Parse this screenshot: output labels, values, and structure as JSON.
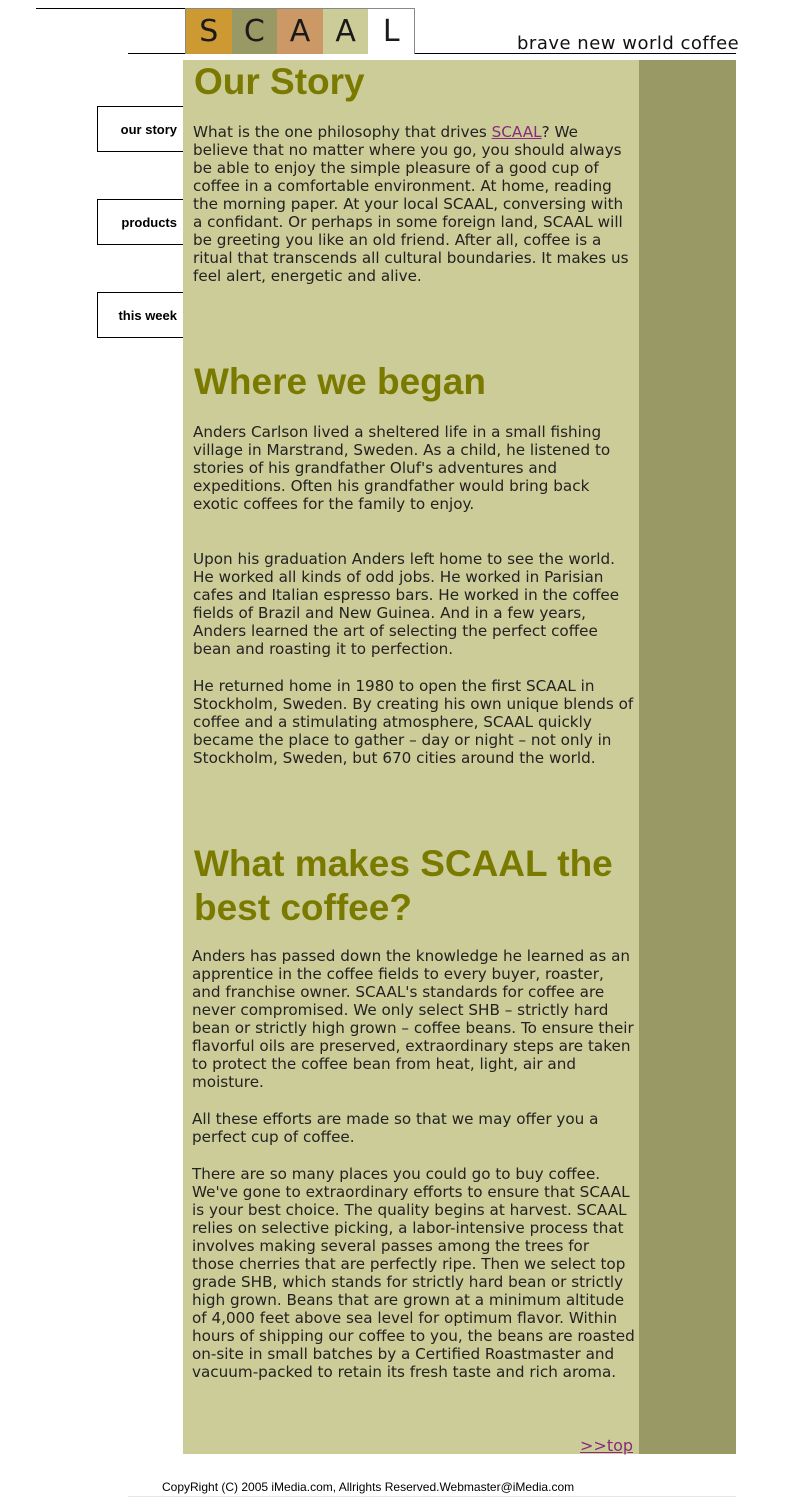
{
  "logo": {
    "letters": [
      "S",
      "C",
      "A",
      "A",
      "L"
    ],
    "colors": [
      "#cc9933",
      "#999966",
      "#cc9966",
      "#cccc99",
      "#ffffff"
    ]
  },
  "tagline": "brave new world coffee",
  "nav": {
    "items": [
      {
        "label": "our story"
      },
      {
        "label": "products"
      },
      {
        "label": "this week"
      }
    ]
  },
  "colors": {
    "content_bg": "#cccc99",
    "sidebar_bg": "#999966",
    "heading": "#7a7a00",
    "link": "#8a2a7a"
  },
  "sections": {
    "our_story": {
      "heading": "Our Story",
      "p1_before": "What is the one philosophy that drives ",
      "p1_link": "SCAAL",
      "p1_after": "? We believe that no matter where you go, you should always be able to enjoy the simple pleasure of a good cup of coffee in a comfortable environment. At home, reading the morning paper. At your local SCAAL, conversing with a confidant. Or perhaps in some foreign land, SCAAL will be greeting you like an old friend. After all, coffee is a ritual that transcends all cultural boundaries. It makes us feel alert, energetic and alive."
    },
    "where_we_began": {
      "heading": "Where we began",
      "paragraphs": [
        "Anders Carlson lived a sheltered life in a small fishing village in Marstrand, Sweden. As a child, he listened to stories of his grandfather Oluf's adventures and expeditions. Often his grandfather would bring back exotic coffees for the family to enjoy.",
        "Upon his graduation Anders left home to see the world. He worked all kinds of odd jobs. He worked in Parisian cafes and Italian espresso bars. He worked in the coffee fields of Brazil and New Guinea. And in a few years, Anders learned the art of selecting the perfect coffee bean and roasting it to perfection.",
        "He returned home in 1980 to open the first SCAAL in Stockholm, Sweden. By creating his own unique blends of coffee and a stimulating atmosphere, SCAAL quickly became the place to gather – day or night – not only in Stockholm, Sweden, but 670 cities around the world."
      ]
    },
    "best_coffee": {
      "heading": "What makes SCAAL the best coffee?",
      "paragraphs": [
        " Anders has passed down the knowledge he learned as an apprentice in the coffee fields to every buyer, roaster, and franchise owner. SCAAL's standards for coffee are never compromised. We only select SHB – strictly hard bean or strictly high grown – coffee beans. To ensure their flavorful oils are preserved, extraordinary steps are taken to protect the coffee bean from heat, light, air and moisture.",
        "All these efforts are made so that we may offer you a perfect cup of coffee.",
        "There are so many places you could go to buy coffee. We've gone to extraordinary efforts to ensure that SCAAL is your best choice. The quality begins at harvest. SCAAL relies on selective picking, a labor-intensive process that involves making several passes among the trees for those cherries that are perfectly ripe. Then we select top grade SHB, which stands for strictly hard bean or strictly high grown. Beans that are grown at a minimum altitude of 4,000 feet above sea level for optimum flavor. Within hours of shipping our coffee to you, the beans are roasted on-site in small batches by a Certified Roastmaster and vacuum-packed to retain its fresh taste and rich aroma."
      ]
    }
  },
  "top_link": ">>top",
  "footer": "CopyRight (C) 2005 iMedia.com, Allrights Reserved.Webmaster@iMedia.com"
}
